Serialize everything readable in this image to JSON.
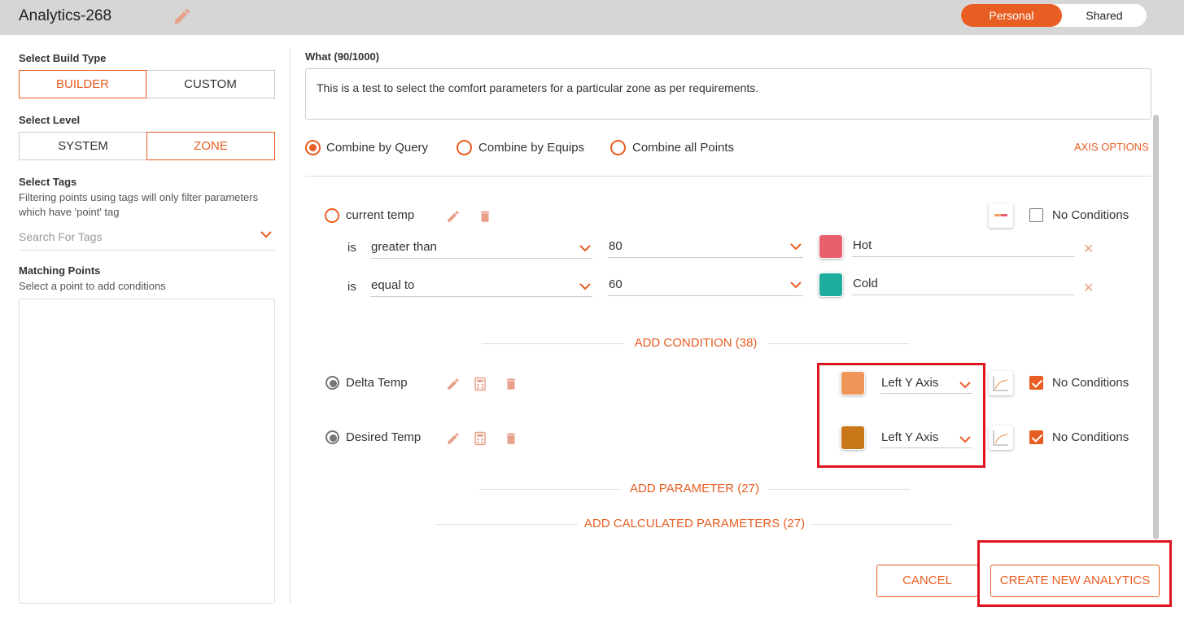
{
  "header": {
    "title": "Analytics-268",
    "toggle": {
      "active": "Personal",
      "inactive": "Shared"
    }
  },
  "sidebar": {
    "build_type_label": "Select Build Type",
    "build_options": [
      "BUILDER",
      "CUSTOM"
    ],
    "level_label": "Select Level",
    "level_options": [
      "SYSTEM",
      "ZONE"
    ],
    "tags_label": "Select Tags",
    "tags_help": "Filtering points using tags will only filter parameters which have 'point' tag",
    "tags_placeholder": "Search For Tags",
    "matching_label": "Matching Points",
    "matching_help": "Select a point to add conditions"
  },
  "main": {
    "what_label": "What (90/1000)",
    "what_text": "This is a test to select the comfort parameters for a particular zone as per requirements.",
    "combine_options": [
      "Combine by Query",
      "Combine by Equips",
      "Combine all Points"
    ],
    "axis_options": "AXIS OPTIONS",
    "parameters": [
      {
        "name": "current temp",
        "no_conditions": "No Conditions",
        "conditions": [
          {
            "is": "is",
            "operator": "greater than",
            "value": "80",
            "color": "#e8606e",
            "label": "Hot"
          },
          {
            "is": "is",
            "operator": "equal to",
            "value": "60",
            "color": "#1fada0",
            "label": "Cold"
          }
        ]
      },
      {
        "name": "Delta Temp",
        "color": "#f0955a",
        "axis": "Left Y Axis",
        "no_conditions": "No Conditions"
      },
      {
        "name": "Desired Temp",
        "color": "#c87718",
        "axis": "Left Y Axis",
        "no_conditions": "No Conditions"
      }
    ],
    "add_condition": "ADD CONDITION (38)",
    "add_parameter": "ADD PARAMETER (27)",
    "add_calculated": "ADD CALCULATED PARAMETERS (27)",
    "cancel": "CANCEL",
    "create": "CREATE NEW ANALYTICS"
  },
  "colors": {
    "accent": "#e85d22",
    "highlight": "#e0141e"
  }
}
